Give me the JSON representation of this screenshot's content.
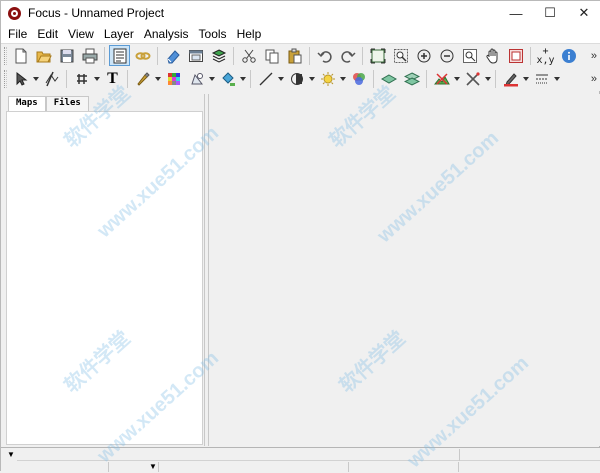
{
  "window": {
    "title": "Focus - Unnamed Project",
    "controls": {
      "minimize": "—",
      "maximize": "☐",
      "close": "✕"
    }
  },
  "menu": [
    {
      "label": "File"
    },
    {
      "label": "Edit"
    },
    {
      "label": "View"
    },
    {
      "label": "Layer"
    },
    {
      "label": "Analysis"
    },
    {
      "label": "Tools"
    },
    {
      "label": "Help"
    }
  ],
  "toolbar1": {
    "xy_label_top": "+",
    "xy_label": "x,y",
    "more": "»"
  },
  "toolbar2": {
    "text_tool": "T",
    "more": "»"
  },
  "left_panel": {
    "tabs": [
      {
        "label": "Maps"
      },
      {
        "label": "Files"
      }
    ]
  },
  "watermark": {
    "text_a": "软件学堂",
    "text_b": "www.xue51.com"
  },
  "colors": {
    "accent": "#5b9bd5",
    "app_icon": "#8b1010",
    "panel_bg": "#ffffff",
    "chrome_bg": "#f0f0f0"
  }
}
